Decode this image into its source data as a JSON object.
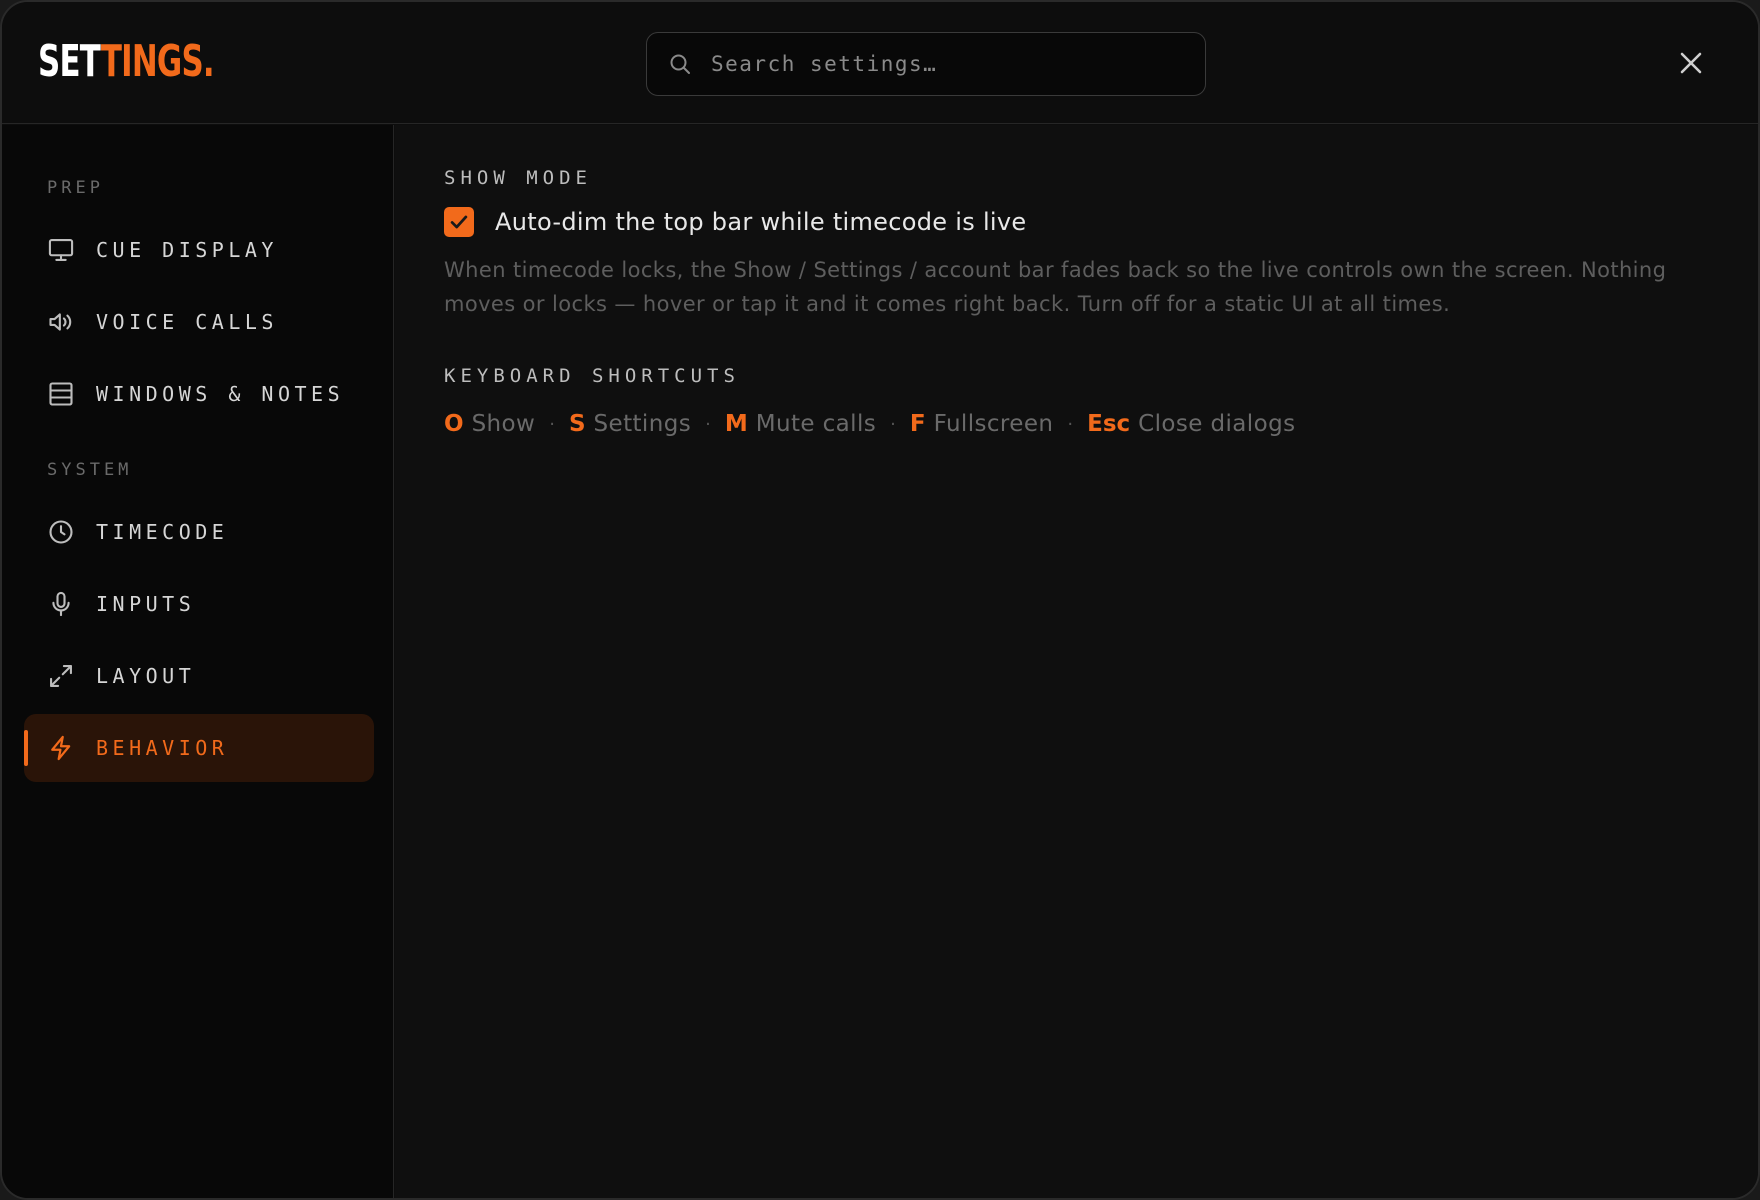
{
  "header": {
    "logo_part1": "SET",
    "logo_part2": "TINGS.",
    "search_placeholder": "Search settings…",
    "close_icon": "close-icon"
  },
  "sidebar": {
    "groups": [
      {
        "label": "PREP",
        "items": [
          {
            "label": "CUE DISPLAY",
            "icon": "monitor-icon"
          },
          {
            "label": "VOICE CALLS",
            "icon": "speaker-icon"
          },
          {
            "label": "WINDOWS & NOTES",
            "icon": "windows-icon"
          }
        ]
      },
      {
        "label": "SYSTEM",
        "items": [
          {
            "label": "TIMECODE",
            "icon": "clock-icon"
          },
          {
            "label": "INPUTS",
            "icon": "microphone-icon"
          },
          {
            "label": "LAYOUT",
            "icon": "expand-icon"
          },
          {
            "label": "BEHAVIOR",
            "icon": "lightning-icon",
            "active": true
          }
        ]
      }
    ]
  },
  "main": {
    "show_mode": {
      "heading": "SHOW MODE",
      "checkbox_label": "Auto-dim the top bar while timecode is live",
      "checked": true,
      "description": "When timecode locks, the Show / Settings / account bar fades back so the live controls own the screen. Nothing moves or locks — hover or tap it and it comes right back. Turn off for a static UI at all times."
    },
    "keyboard": {
      "heading": "KEYBOARD SHORTCUTS",
      "separator": "·",
      "shortcuts": [
        {
          "key": "O",
          "action": "Show"
        },
        {
          "key": "S",
          "action": "Settings"
        },
        {
          "key": "M",
          "action": "Mute calls"
        },
        {
          "key": "F",
          "action": "Fullscreen"
        },
        {
          "key": "Esc",
          "action": "Close dialogs"
        }
      ]
    }
  },
  "colors": {
    "accent": "#f26a1b",
    "background": "#0d0d0d",
    "sidebar": "#080808",
    "active_item_bg": "#2a1408"
  }
}
